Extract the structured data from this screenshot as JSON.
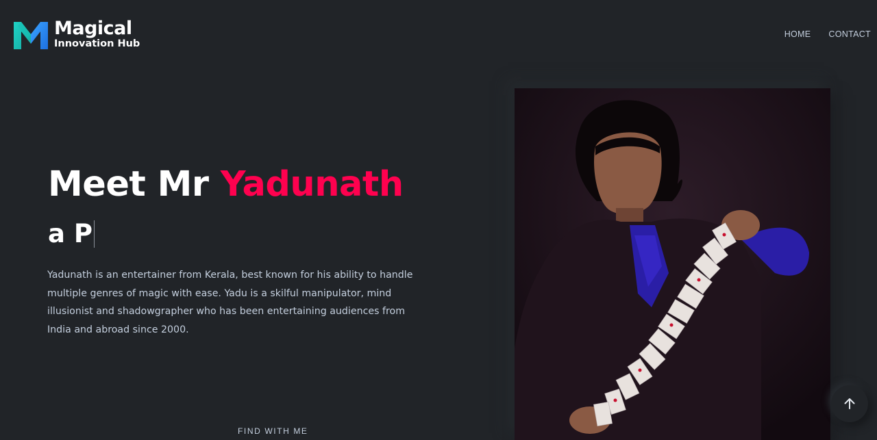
{
  "brand": {
    "title": "Magical",
    "subtitle": "Innovation Hub",
    "logo_icon": "m-logo-icon",
    "colors": {
      "logo_left": "#1fd3c6",
      "logo_right": "#2a8cff"
    }
  },
  "nav": {
    "items": [
      {
        "label": "HOME"
      },
      {
        "label": "CONTACT"
      }
    ]
  },
  "hero": {
    "title_prefix": "Meet Mr",
    "title_name": "Yadunath",
    "typed_text": "a P",
    "description": "Yadunath is an entertainer from Kerala, best known for his ability to handle multiple genres of magic with ease. Yadu is a skilful manipulator, mind illusionist and shadowgrapher who has been entertaining audiences from India and abroad since 2000.",
    "find_label": "FIND WITH ME",
    "accent_color": "#ff014f"
  },
  "photo": {
    "subject": "magician-card-flourish"
  },
  "scroll_top": {
    "icon": "arrow-up-icon"
  }
}
